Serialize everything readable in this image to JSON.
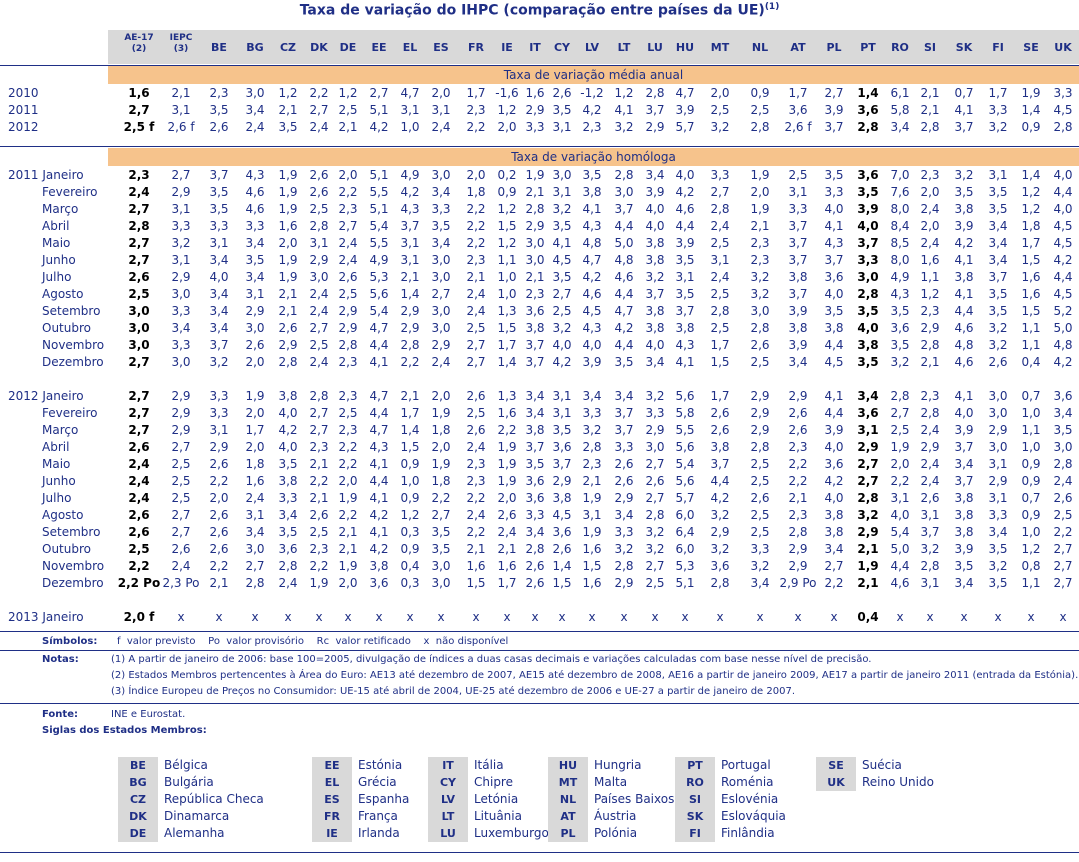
{
  "title": "Taxa de variação do IHPC (comparação entre países da UE)",
  "title_sup": "(1)",
  "headers": {
    "ae17": "AE-17",
    "ae17_sup": "(2)",
    "iepc": "IEPC",
    "iepc_sup": "(3)",
    "countries": [
      "BE",
      "BG",
      "CZ",
      "DK",
      "DE",
      "EE",
      "EL",
      "ES",
      "FR",
      "IE",
      "IT",
      "CY",
      "LV",
      "LT",
      "LU",
      "HU",
      "MT",
      "NL",
      "AT",
      "PL",
      "PT",
      "RO",
      "SI",
      "SK",
      "FI",
      "SE",
      "UK"
    ]
  },
  "band_annual": "Taxa de variação média anual",
  "band_homologa": "Taxa de variação homóloga",
  "annual_rows": [
    {
      "label": "2010",
      "values": [
        "1,6",
        "2,1",
        "2,3",
        "3,0",
        "1,2",
        "2,2",
        "1,2",
        "2,7",
        "4,7",
        "2,0",
        "1,7",
        "-1,6",
        "1,6",
        "2,6",
        "-1,2",
        "1,2",
        "2,8",
        "4,7",
        "2,0",
        "0,9",
        "1,7",
        "2,7",
        "1,4",
        "6,1",
        "2,1",
        "0,7",
        "1,7",
        "1,9",
        "3,3"
      ]
    },
    {
      "label": "2011",
      "values": [
        "2,7",
        "3,1",
        "3,5",
        "3,4",
        "2,1",
        "2,7",
        "2,5",
        "5,1",
        "3,1",
        "3,1",
        "2,3",
        "1,2",
        "2,9",
        "3,5",
        "4,2",
        "4,1",
        "3,7",
        "3,9",
        "2,5",
        "2,5",
        "3,6",
        "3,9",
        "3,6",
        "5,8",
        "2,1",
        "4,1",
        "3,3",
        "1,4",
        "4,5"
      ]
    },
    {
      "label": "2012",
      "values": [
        "2,5 f",
        "2,6 f",
        "2,6",
        "2,4",
        "3,5",
        "2,4",
        "2,1",
        "4,2",
        "1,0",
        "2,4",
        "2,2",
        "2,0",
        "3,3",
        "3,1",
        "2,3",
        "3,2",
        "2,9",
        "5,7",
        "3,2",
        "2,8",
        "2,6 f",
        "3,7",
        "2,8",
        "3,4",
        "2,8",
        "3,7",
        "3,2",
        "0,9",
        "2,8"
      ]
    }
  ],
  "monthly_2011": [
    {
      "label": "2011 Janeiro",
      "values": [
        "2,3",
        "2,7",
        "3,7",
        "4,3",
        "1,9",
        "2,6",
        "2,0",
        "5,1",
        "4,9",
        "3,0",
        "2,0",
        "0,2",
        "1,9",
        "3,0",
        "3,5",
        "2,8",
        "3,4",
        "4,0",
        "3,3",
        "1,9",
        "2,5",
        "3,5",
        "3,6",
        "7,0",
        "2,3",
        "3,2",
        "3,1",
        "1,4",
        "4,0"
      ]
    },
    {
      "label": "Fevereiro",
      "values": [
        "2,4",
        "2,9",
        "3,5",
        "4,6",
        "1,9",
        "2,6",
        "2,2",
        "5,5",
        "4,2",
        "3,4",
        "1,8",
        "0,9",
        "2,1",
        "3,1",
        "3,8",
        "3,0",
        "3,9",
        "4,2",
        "2,7",
        "2,0",
        "3,1",
        "3,3",
        "3,5",
        "7,6",
        "2,0",
        "3,5",
        "3,5",
        "1,2",
        "4,4"
      ]
    },
    {
      "label": "Março",
      "values": [
        "2,7",
        "3,1",
        "3,5",
        "4,6",
        "1,9",
        "2,5",
        "2,3",
        "5,1",
        "4,3",
        "3,3",
        "2,2",
        "1,2",
        "2,8",
        "3,2",
        "4,1",
        "3,7",
        "4,0",
        "4,6",
        "2,8",
        "1,9",
        "3,3",
        "4,0",
        "3,9",
        "8,0",
        "2,4",
        "3,8",
        "3,5",
        "1,2",
        "4,0"
      ]
    },
    {
      "label": "Abril",
      "values": [
        "2,8",
        "3,3",
        "3,3",
        "3,3",
        "1,6",
        "2,8",
        "2,7",
        "5,4",
        "3,7",
        "3,5",
        "2,2",
        "1,5",
        "2,9",
        "3,5",
        "4,3",
        "4,4",
        "4,0",
        "4,4",
        "2,4",
        "2,1",
        "3,7",
        "4,1",
        "4,0",
        "8,4",
        "2,0",
        "3,9",
        "3,4",
        "1,8",
        "4,5"
      ]
    },
    {
      "label": "Maio",
      "values": [
        "2,7",
        "3,2",
        "3,1",
        "3,4",
        "2,0",
        "3,1",
        "2,4",
        "5,5",
        "3,1",
        "3,4",
        "2,2",
        "1,2",
        "3,0",
        "4,1",
        "4,8",
        "5,0",
        "3,8",
        "3,9",
        "2,5",
        "2,3",
        "3,7",
        "4,3",
        "3,7",
        "8,5",
        "2,4",
        "4,2",
        "3,4",
        "1,7",
        "4,5"
      ]
    },
    {
      "label": "Junho",
      "values": [
        "2,7",
        "3,1",
        "3,4",
        "3,5",
        "1,9",
        "2,9",
        "2,4",
        "4,9",
        "3,1",
        "3,0",
        "2,3",
        "1,1",
        "3,0",
        "4,5",
        "4,7",
        "4,8",
        "3,8",
        "3,5",
        "3,1",
        "2,3",
        "3,7",
        "3,7",
        "3,3",
        "8,0",
        "1,6",
        "4,1",
        "3,4",
        "1,5",
        "4,2"
      ]
    },
    {
      "label": "Julho",
      "values": [
        "2,6",
        "2,9",
        "4,0",
        "3,4",
        "1,9",
        "3,0",
        "2,6",
        "5,3",
        "2,1",
        "3,0",
        "2,1",
        "1,0",
        "2,1",
        "3,5",
        "4,2",
        "4,6",
        "3,2",
        "3,1",
        "2,4",
        "3,2",
        "3,8",
        "3,6",
        "3,0",
        "4,9",
        "1,1",
        "3,8",
        "3,7",
        "1,6",
        "4,4"
      ]
    },
    {
      "label": "Agosto",
      "values": [
        "2,5",
        "3,0",
        "3,4",
        "3,1",
        "2,1",
        "2,4",
        "2,5",
        "5,6",
        "1,4",
        "2,7",
        "2,4",
        "1,0",
        "2,3",
        "2,7",
        "4,6",
        "4,4",
        "3,7",
        "3,5",
        "2,5",
        "3,2",
        "3,7",
        "4,0",
        "2,8",
        "4,3",
        "1,2",
        "4,1",
        "3,5",
        "1,6",
        "4,5"
      ]
    },
    {
      "label": "Setembro",
      "values": [
        "3,0",
        "3,3",
        "3,4",
        "2,9",
        "2,1",
        "2,4",
        "2,9",
        "5,4",
        "2,9",
        "3,0",
        "2,4",
        "1,3",
        "3,6",
        "2,5",
        "4,5",
        "4,7",
        "3,8",
        "3,7",
        "2,8",
        "3,0",
        "3,9",
        "3,5",
        "3,5",
        "3,5",
        "2,3",
        "4,4",
        "3,5",
        "1,5",
        "5,2"
      ]
    },
    {
      "label": "Outubro",
      "values": [
        "3,0",
        "3,4",
        "3,4",
        "3,0",
        "2,6",
        "2,7",
        "2,9",
        "4,7",
        "2,9",
        "3,0",
        "2,5",
        "1,5",
        "3,8",
        "3,2",
        "4,3",
        "4,2",
        "3,8",
        "3,8",
        "2,5",
        "2,8",
        "3,8",
        "3,8",
        "4,0",
        "3,6",
        "2,9",
        "4,6",
        "3,2",
        "1,1",
        "5,0"
      ]
    },
    {
      "label": "Novembro",
      "values": [
        "3,0",
        "3,3",
        "3,7",
        "2,6",
        "2,9",
        "2,5",
        "2,8",
        "4,4",
        "2,8",
        "2,9",
        "2,7",
        "1,7",
        "3,7",
        "4,0",
        "4,0",
        "4,4",
        "4,0",
        "4,3",
        "1,7",
        "2,6",
        "3,9",
        "4,4",
        "3,8",
        "3,5",
        "2,8",
        "4,8",
        "3,2",
        "1,1",
        "4,8"
      ]
    },
    {
      "label": "Dezembro",
      "values": [
        "2,7",
        "3,0",
        "3,2",
        "2,0",
        "2,8",
        "2,4",
        "2,3",
        "4,1",
        "2,2",
        "2,4",
        "2,7",
        "1,4",
        "3,7",
        "4,2",
        "3,9",
        "3,5",
        "3,4",
        "4,1",
        "1,5",
        "2,5",
        "3,4",
        "4,5",
        "3,5",
        "3,2",
        "2,1",
        "4,6",
        "2,6",
        "0,4",
        "4,2"
      ]
    }
  ],
  "monthly_2012": [
    {
      "label": "2012 Janeiro",
      "values": [
        "2,7",
        "2,9",
        "3,3",
        "1,9",
        "3,8",
        "2,8",
        "2,3",
        "4,7",
        "2,1",
        "2,0",
        "2,6",
        "1,3",
        "3,4",
        "3,1",
        "3,4",
        "3,4",
        "3,2",
        "5,6",
        "1,7",
        "2,9",
        "2,9",
        "4,1",
        "3,4",
        "2,8",
        "2,3",
        "4,1",
        "3,0",
        "0,7",
        "3,6"
      ]
    },
    {
      "label": "Fevereiro",
      "values": [
        "2,7",
        "2,9",
        "3,3",
        "2,0",
        "4,0",
        "2,7",
        "2,5",
        "4,4",
        "1,7",
        "1,9",
        "2,5",
        "1,6",
        "3,4",
        "3,1",
        "3,3",
        "3,7",
        "3,3",
        "5,8",
        "2,6",
        "2,9",
        "2,6",
        "4,4",
        "3,6",
        "2,7",
        "2,8",
        "4,0",
        "3,0",
        "1,0",
        "3,4"
      ]
    },
    {
      "label": "Março",
      "values": [
        "2,7",
        "2,9",
        "3,1",
        "1,7",
        "4,2",
        "2,7",
        "2,3",
        "4,7",
        "1,4",
        "1,8",
        "2,6",
        "2,2",
        "3,8",
        "3,5",
        "3,2",
        "3,7",
        "2,9",
        "5,5",
        "2,6",
        "2,9",
        "2,6",
        "3,9",
        "3,1",
        "2,5",
        "2,4",
        "3,9",
        "2,9",
        "1,1",
        "3,5"
      ]
    },
    {
      "label": "Abril",
      "values": [
        "2,6",
        "2,7",
        "2,9",
        "2,0",
        "4,0",
        "2,3",
        "2,2",
        "4,3",
        "1,5",
        "2,0",
        "2,4",
        "1,9",
        "3,7",
        "3,6",
        "2,8",
        "3,3",
        "3,0",
        "5,6",
        "3,8",
        "2,8",
        "2,3",
        "4,0",
        "2,9",
        "1,9",
        "2,9",
        "3,7",
        "3,0",
        "1,0",
        "3,0"
      ]
    },
    {
      "label": "Maio",
      "values": [
        "2,4",
        "2,5",
        "2,6",
        "1,8",
        "3,5",
        "2,1",
        "2,2",
        "4,1",
        "0,9",
        "1,9",
        "2,3",
        "1,9",
        "3,5",
        "3,7",
        "2,3",
        "2,6",
        "2,7",
        "5,4",
        "3,7",
        "2,5",
        "2,2",
        "3,6",
        "2,7",
        "2,0",
        "2,4",
        "3,4",
        "3,1",
        "0,9",
        "2,8"
      ]
    },
    {
      "label": "Junho",
      "values": [
        "2,4",
        "2,5",
        "2,2",
        "1,6",
        "3,8",
        "2,2",
        "2,0",
        "4,4",
        "1,0",
        "1,8",
        "2,3",
        "1,9",
        "3,6",
        "2,9",
        "2,1",
        "2,6",
        "2,6",
        "5,6",
        "4,4",
        "2,5",
        "2,2",
        "4,2",
        "2,7",
        "2,2",
        "2,4",
        "3,7",
        "2,9",
        "0,9",
        "2,4"
      ]
    },
    {
      "label": "Julho",
      "values": [
        "2,4",
        "2,5",
        "2,0",
        "2,4",
        "3,3",
        "2,1",
        "1,9",
        "4,1",
        "0,9",
        "2,2",
        "2,2",
        "2,0",
        "3,6",
        "3,8",
        "1,9",
        "2,9",
        "2,7",
        "5,7",
        "4,2",
        "2,6",
        "2,1",
        "4,0",
        "2,8",
        "3,1",
        "2,6",
        "3,8",
        "3,1",
        "0,7",
        "2,6"
      ]
    },
    {
      "label": "Agosto",
      "values": [
        "2,6",
        "2,7",
        "2,6",
        "3,1",
        "3,4",
        "2,6",
        "2,2",
        "4,2",
        "1,2",
        "2,7",
        "2,4",
        "2,6",
        "3,3",
        "4,5",
        "3,1",
        "3,4",
        "2,8",
        "6,0",
        "3,2",
        "2,5",
        "2,3",
        "3,8",
        "3,2",
        "4,0",
        "3,1",
        "3,8",
        "3,3",
        "0,9",
        "2,5"
      ]
    },
    {
      "label": "Setembro",
      "values": [
        "2,6",
        "2,7",
        "2,6",
        "3,4",
        "3,5",
        "2,5",
        "2,1",
        "4,1",
        "0,3",
        "3,5",
        "2,2",
        "2,4",
        "3,4",
        "3,6",
        "1,9",
        "3,3",
        "3,2",
        "6,4",
        "2,9",
        "2,5",
        "2,8",
        "3,8",
        "2,9",
        "5,4",
        "3,7",
        "3,8",
        "3,4",
        "1,0",
        "2,2"
      ]
    },
    {
      "label": "Outubro",
      "values": [
        "2,5",
        "2,6",
        "2,6",
        "3,0",
        "3,6",
        "2,3",
        "2,1",
        "4,2",
        "0,9",
        "3,5",
        "2,1",
        "2,1",
        "2,8",
        "2,6",
        "1,6",
        "3,2",
        "3,2",
        "6,0",
        "3,2",
        "3,3",
        "2,9",
        "3,4",
        "2,1",
        "5,0",
        "3,2",
        "3,9",
        "3,5",
        "1,2",
        "2,7"
      ]
    },
    {
      "label": "Novembro",
      "values": [
        "2,2",
        "2,4",
        "2,2",
        "2,7",
        "2,8",
        "2,2",
        "1,9",
        "3,8",
        "0,4",
        "3,0",
        "1,6",
        "1,6",
        "2,6",
        "1,4",
        "1,5",
        "2,8",
        "2,7",
        "5,3",
        "3,6",
        "3,2",
        "2,9",
        "2,7",
        "1,9",
        "4,4",
        "2,8",
        "3,5",
        "3,2",
        "0,8",
        "2,7"
      ]
    },
    {
      "label": "Dezembro",
      "values": [
        "2,2 Po",
        "2,3 Po",
        "2,1",
        "2,8",
        "2,4",
        "1,9",
        "2,0",
        "3,6",
        "0,3",
        "3,0",
        "1,5",
        "1,7",
        "2,6",
        "1,5",
        "1,6",
        "2,9",
        "2,5",
        "5,1",
        "2,8",
        "3,4",
        "2,9 Po",
        "2,2",
        "2,1",
        "4,6",
        "3,1",
        "3,4",
        "3,5",
        "1,1",
        "2,7"
      ]
    }
  ],
  "row_2013": {
    "label": "2013 Janeiro",
    "values": [
      "2,0 f",
      "x",
      "x",
      "x",
      "x",
      "x",
      "x",
      "x",
      "x",
      "x",
      "x",
      "x",
      "x",
      "x",
      "x",
      "x",
      "x",
      "x",
      "x",
      "x",
      "x",
      "x",
      "0,4",
      "x",
      "x",
      "x",
      "x",
      "x",
      "x"
    ]
  },
  "simbolos": {
    "label": "Símbolos:",
    "text": "f  valor previsto    Po  valor provisório    Rc  valor retificado    x  não disponível"
  },
  "notas": {
    "label": "Notas:",
    "lines": [
      "(1) A partir de janeiro de 2006: base 100=2005, divulgação de índices a duas casas decimais e variações calculadas com base nesse nível de precisão.",
      "(2) Estados Membros pertencentes à Área do Euro: AE13 até dezembro de 2007, AE15 até dezembro de 2008, AE16 a partir de janeiro 2009, AE17 a partir de janeiro 2011 (entrada da Estónia).",
      "(3) Índice Europeu de Preços no Consumidor: UE-15 até abril de 2004, UE-25 até dezembro de 2006 e UE-27 a partir de janeiro de 2007."
    ]
  },
  "fonte": {
    "label": "Fonte:",
    "text": "INE e Eurostat."
  },
  "siglas_label": "Siglas dos Estados Membros:",
  "siglas": [
    [
      {
        "c": "BE",
        "n": "Bélgica"
      },
      {
        "c": "BG",
        "n": "Bulgária"
      },
      {
        "c": "CZ",
        "n": "República Checa"
      },
      {
        "c": "DK",
        "n": "Dinamarca"
      },
      {
        "c": "DE",
        "n": "Alemanha"
      }
    ],
    [
      {
        "c": "EE",
        "n": "Estónia"
      },
      {
        "c": "EL",
        "n": "Grécia"
      },
      {
        "c": "ES",
        "n": "Espanha"
      },
      {
        "c": "FR",
        "n": "França"
      },
      {
        "c": "IE",
        "n": "Irlanda"
      }
    ],
    [
      {
        "c": "IT",
        "n": "Itália"
      },
      {
        "c": "CY",
        "n": "Chipre"
      },
      {
        "c": "LV",
        "n": "Letónia"
      },
      {
        "c": "LT",
        "n": "Lituânia"
      },
      {
        "c": "LU",
        "n": "Luxemburgo"
      }
    ],
    [
      {
        "c": "HU",
        "n": "Hungria"
      },
      {
        "c": "MT",
        "n": "Malta"
      },
      {
        "c": "NL",
        "n": "Países Baixos"
      },
      {
        "c": "AT",
        "n": "Áustria"
      },
      {
        "c": "PL",
        "n": "Polónia"
      }
    ],
    [
      {
        "c": "PT",
        "n": "Portugal"
      },
      {
        "c": "RO",
        "n": "Roménia"
      },
      {
        "c": "SI",
        "n": "Eslovénia"
      },
      {
        "c": "SK",
        "n": "Eslováquia"
      },
      {
        "c": "FI",
        "n": "Finlândia"
      }
    ],
    [
      {
        "c": "SE",
        "n": "Suécia"
      },
      {
        "c": "UK",
        "n": "Reino Unido"
      }
    ]
  ]
}
